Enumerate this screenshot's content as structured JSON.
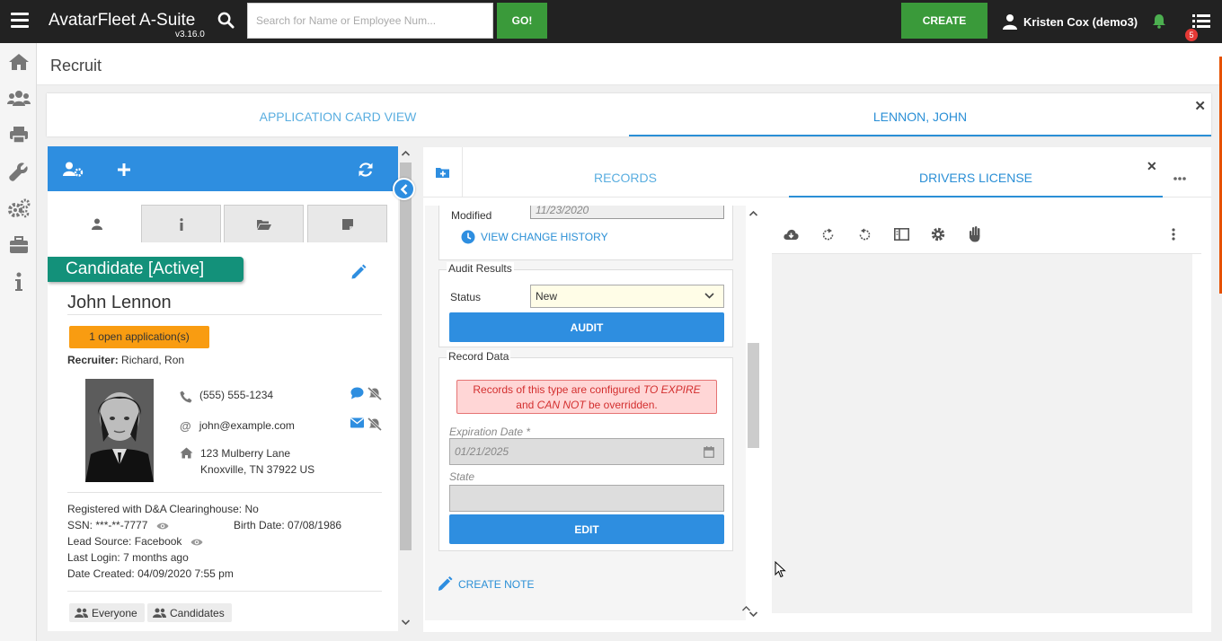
{
  "topbar": {
    "app_title": "AvatarFleet A-Suite",
    "version": "v3.16.0",
    "search_placeholder": "Search for Name or Employee Num...",
    "go_label": "GO!",
    "create_label": "CREATE",
    "user_label": "Kristen Cox (demo3)",
    "notification_count": "5"
  },
  "sidebar": {
    "items": [
      "home-icon",
      "users-icon",
      "print-icon",
      "wrench-icon",
      "gears-icon",
      "briefcase-icon",
      "info-icon"
    ]
  },
  "page": {
    "title": "Recruit"
  },
  "main_tabs": {
    "application_card": "APPLICATION CARD VIEW",
    "candidate": "LENNON, JOHN"
  },
  "candidate": {
    "status": "Candidate [Active]",
    "name": "John Lennon",
    "open_applications": "1 open application(s)",
    "recruiter_label": "Recruiter:",
    "recruiter_value": "Richard, Ron",
    "phone": "(555) 555-1234",
    "email": "john@example.com",
    "address_line1": "123 Mulberry Lane",
    "address_line2": "Knoxville, TN 37922 US",
    "clearinghouse_label": "Registered with D&A Clearinghouse:",
    "clearinghouse_value": "No",
    "ssn_label": "SSN:",
    "ssn_value": "***-**-7777",
    "birth_label": "Birth Date:",
    "birth_value": "07/08/1986",
    "lead_label": "Lead Source:",
    "lead_value": "Facebook",
    "login_label": "Last Login:",
    "login_value": "7 months ago",
    "created_label": "Date Created:",
    "created_value": "04/09/2020 7:55 pm",
    "chips": [
      "Everyone",
      "Candidates"
    ]
  },
  "records": {
    "tab_records": "RECORDS",
    "tab_license": "DRIVERS LICENSE",
    "modified_label": "Modified",
    "modified_value": "11/23/2020",
    "history_link": "VIEW CHANGE HISTORY",
    "audit_legend": "Audit Results",
    "status_label": "Status",
    "status_value": "New",
    "audit_button": "AUDIT",
    "record_legend": "Record Data",
    "alert_part1": "Records of this type are configured",
    "alert_em1": "TO EXPIRE",
    "alert_part2": "and",
    "alert_em2": "CAN NOT",
    "alert_part3": "be overridden.",
    "expiration_label": "Expiration Date *",
    "expiration_value": "01/21/2025",
    "state_label": "State",
    "state_value": "",
    "edit_button": "EDIT",
    "create_note": "CREATE NOTE"
  },
  "colors": {
    "accent": "#2e8ee0",
    "green": "#3a9a3a",
    "status_tag": "#13917a",
    "orange": "#f99c11",
    "alert_bg": "#ffd6d6"
  }
}
